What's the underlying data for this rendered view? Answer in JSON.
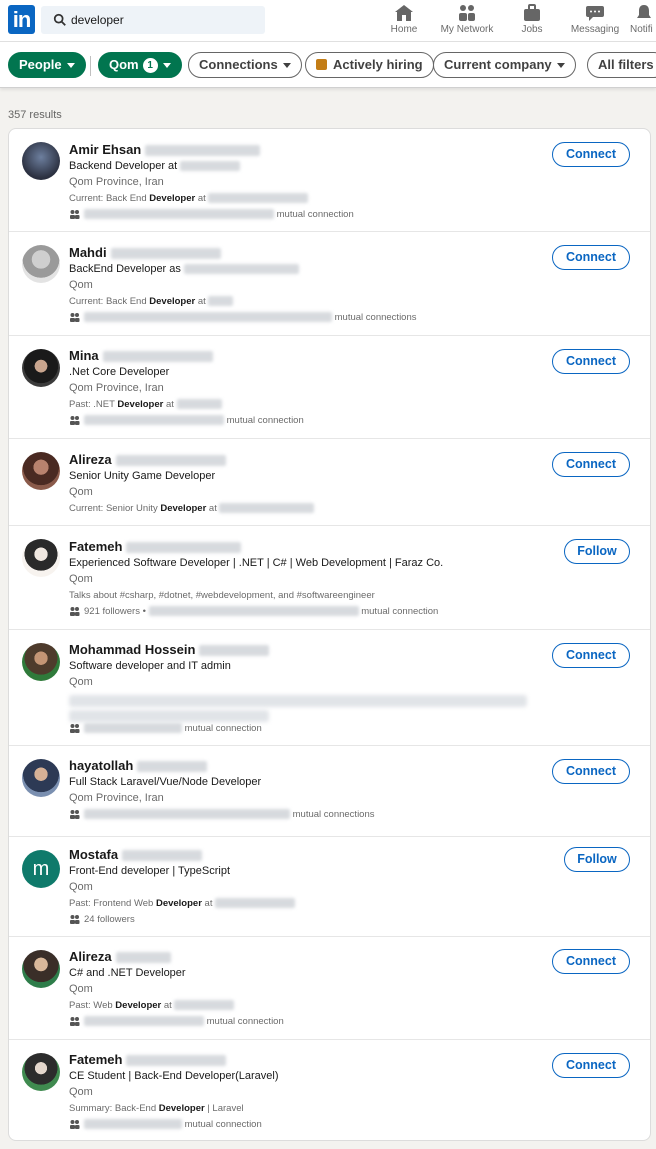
{
  "nav": {
    "logo": "in",
    "search_value": "developer",
    "items": [
      {
        "label": "Home",
        "icon": "home-icon"
      },
      {
        "label": "My Network",
        "icon": "network-icon"
      },
      {
        "label": "Jobs",
        "icon": "jobs-icon"
      },
      {
        "label": "Messaging",
        "icon": "messaging-icon"
      },
      {
        "label": "Notifi",
        "icon": "notifications-icon"
      }
    ]
  },
  "filters": {
    "people": "People",
    "location": "Qom",
    "location_count": "1",
    "connections": "Connections",
    "hiring": "Actively hiring",
    "company": "Current company",
    "all": "All filters"
  },
  "results_count": "357 results",
  "people": [
    {
      "name": "Amir Ehsan",
      "headline": "Backend Developer at",
      "location": "Qom Province, Iran",
      "detail_prefix": "Current: Back End ",
      "detail_bold": "Developer",
      "detail_suffix": " at",
      "mutual": "mutual connection",
      "action": "Connect"
    },
    {
      "name": "Mahdi",
      "headline": "BackEnd Developer as",
      "location": "Qom",
      "detail_prefix": "Current: Back End ",
      "detail_bold": "Developer",
      "detail_suffix": " at",
      "mutual": "mutual connections",
      "action": "Connect"
    },
    {
      "name": "Mina",
      "headline": ".Net Core Developer",
      "location": "Qom Province, Iran",
      "detail_prefix": "Past: .NET ",
      "detail_bold": "Developer",
      "detail_suffix": " at",
      "mutual": "mutual connection",
      "action": "Connect"
    },
    {
      "name": "Alireza",
      "headline": "Senior Unity Game Developer",
      "location": "Qom",
      "detail_prefix": "Current: Senior Unity ",
      "detail_bold": "Developer",
      "detail_suffix": " at",
      "mutual": "",
      "action": "Connect"
    },
    {
      "name": "Fatemeh",
      "headline": "Experienced Software Developer | .NET | C# | Web Development | Faraz Co.",
      "location": "Qom",
      "detail_prefix": "Talks about #csharp, #dotnet, #webdevelopment, and #softwareengineer",
      "detail_bold": "",
      "detail_suffix": "",
      "followers": "921 followers •",
      "mutual": "mutual connection",
      "action": "Follow"
    },
    {
      "name": "Mohammad Hossein",
      "headline": "Software developer and IT admin",
      "location": "Qom",
      "detail_prefix": "",
      "detail_bold": "",
      "detail_suffix": "",
      "mutual": "mutual connection",
      "action": "Connect"
    },
    {
      "name": "hayatollah",
      "headline": "Full Stack Laravel/Vue/Node Developer",
      "location": "Qom Province, Iran",
      "detail_prefix": "",
      "detail_bold": "",
      "detail_suffix": "",
      "mutual": "mutual connections",
      "action": "Connect"
    },
    {
      "name": "Mostafa",
      "headline": "Front-End developer | TypeScript",
      "location": "Qom",
      "detail_prefix": "Past: Frontend Web ",
      "detail_bold": "Developer",
      "detail_suffix": " at",
      "followers": "24 followers",
      "mutual": "",
      "action": "Follow"
    },
    {
      "name": "Alireza",
      "headline": "C# and .NET Developer",
      "location": "Qom",
      "detail_prefix": "Past: Web ",
      "detail_bold": "Developer",
      "detail_suffix": " at",
      "mutual": "mutual connection",
      "action": "Connect"
    },
    {
      "name": "Fatemeh",
      "headline": "CE Student | Back-End Developer(Laravel)",
      "location": "Qom",
      "detail_prefix": "Summary: Back-End ",
      "detail_bold": "Developer",
      "detail_suffix": " | Laravel",
      "mutual": "mutual connection",
      "action": "Connect"
    }
  ],
  "colors": {
    "linkedin_blue": "#0a66c2",
    "filter_green": "#01754f"
  }
}
